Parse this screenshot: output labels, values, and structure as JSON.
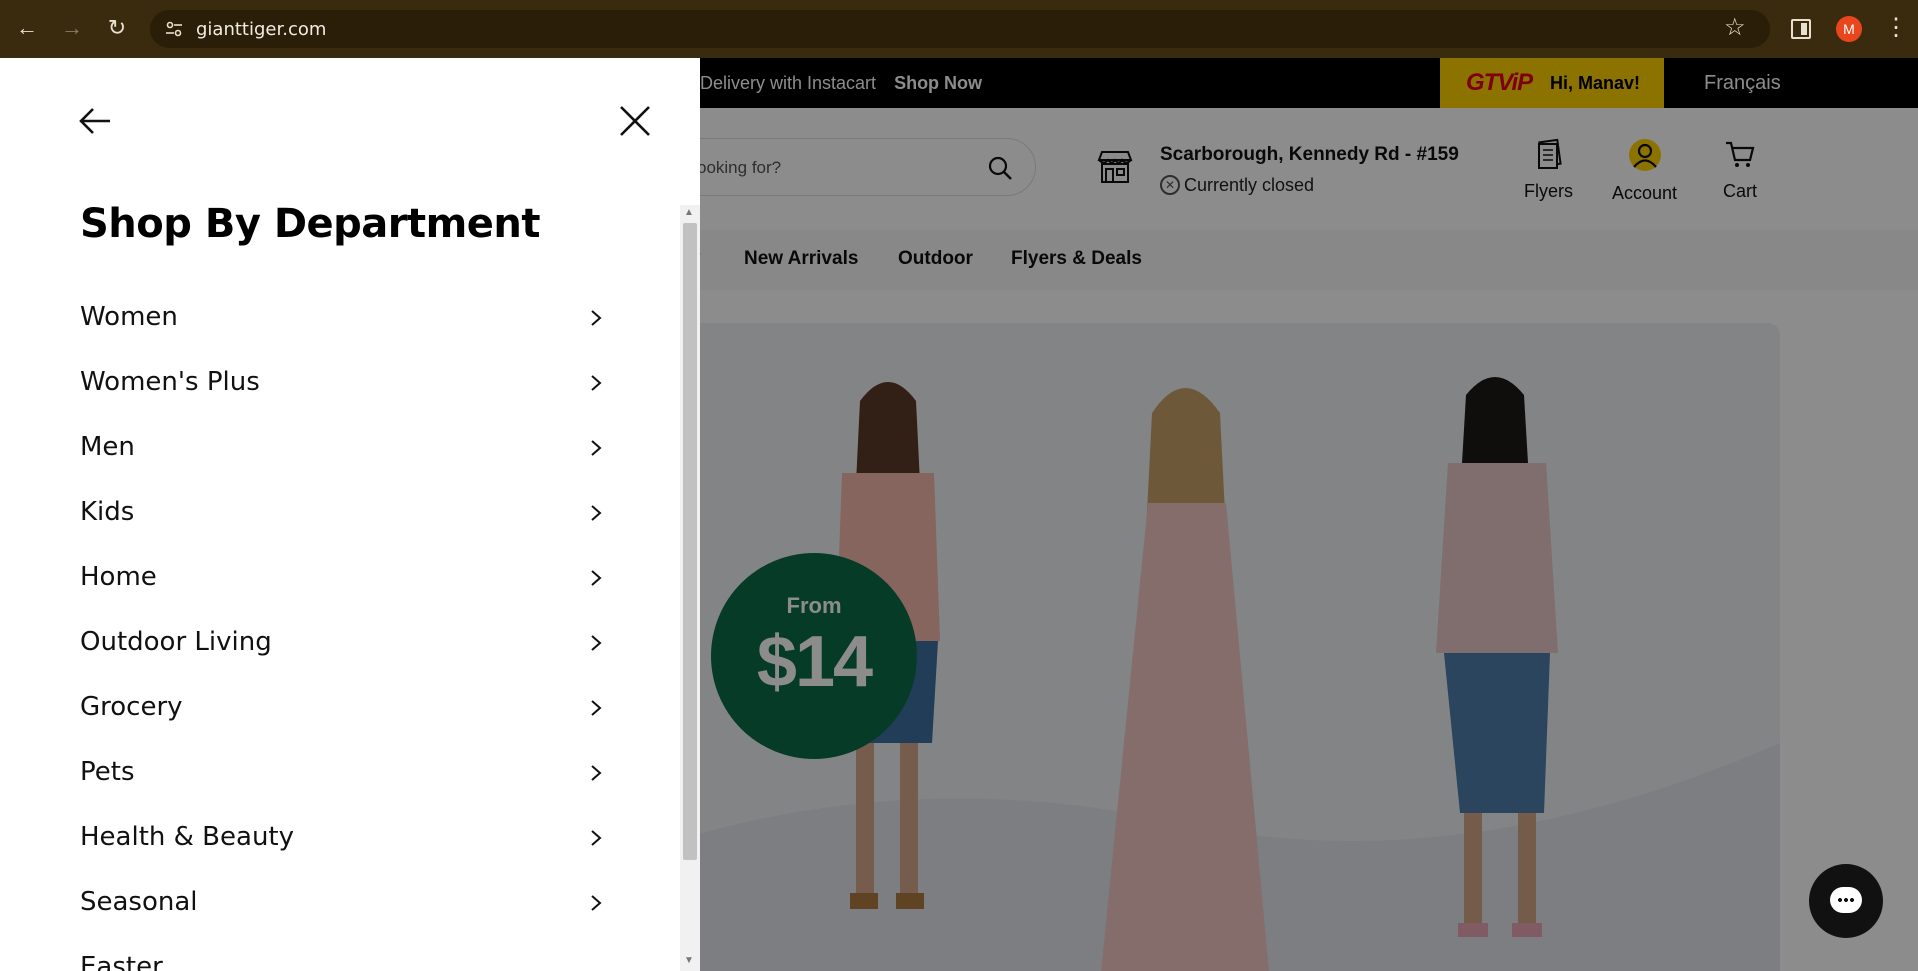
{
  "browser": {
    "url": "gianttiger.com",
    "profile_initial": "M"
  },
  "topbar": {
    "promo_text": "Delivery with Instacart",
    "promo_link": "Shop Now",
    "vip_logo_a": "GT",
    "vip_logo_b": "ViP",
    "greeting": "Hi, Manav!",
    "language": "Français"
  },
  "header": {
    "search_placeholder": "ooking for?",
    "store_name": "Scarborough, Kennedy Rd - #159",
    "store_status": "Currently closed",
    "flyers": "Flyers",
    "account": "Account",
    "cart": "Cart"
  },
  "menu": {
    "partial": "y",
    "items": [
      "New Arrivals",
      "Outdoor",
      "Flyers & Deals"
    ]
  },
  "hero": {
    "badge_from": "From",
    "badge_price": "$14"
  },
  "drawer": {
    "title": "Shop By Department",
    "departments": [
      "Women",
      "Women's Plus",
      "Men",
      "Kids",
      "Home",
      "Outdoor Living",
      "Grocery",
      "Pets",
      "Health & Beauty",
      "Seasonal",
      "Easter"
    ]
  },
  "colors": {
    "chrome": "#3b2b0e",
    "vip_yellow": "#ffd200",
    "badge_green": "#0c6c48"
  }
}
